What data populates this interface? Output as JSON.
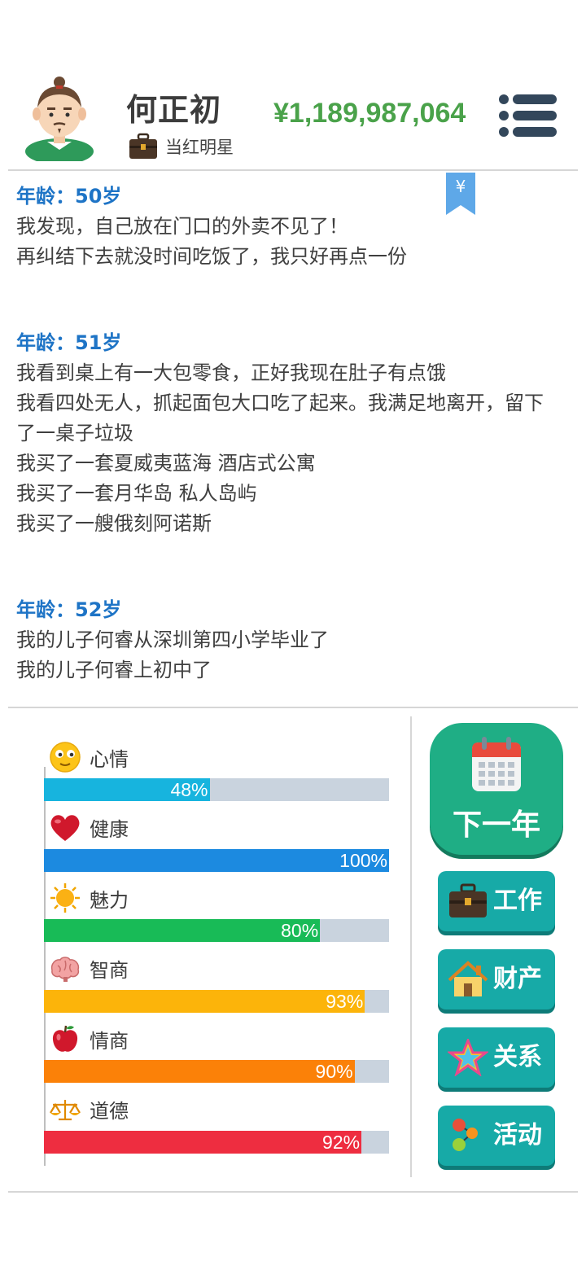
{
  "player": {
    "name": "何正初",
    "job": "当红明星",
    "money": "¥1,189,987,064"
  },
  "log": [
    {
      "age": "年龄：50岁",
      "events": [
        "我发现，自己放在门口的外卖不见了！",
        "再纠结下去就没时间吃饭了，我只好再点一份"
      ]
    },
    {
      "age": "年龄：51岁",
      "events": [
        "我看到桌上有一大包零食，正好我现在肚子有点饿",
        "我看四处无人，抓起面包大口吃了起来。我满足地离开，留下了一桌子垃圾",
        "我买了一套夏威夷蓝海 酒店式公寓",
        "我买了一套月华岛 私人岛屿",
        "我买了一艘俄刻阿诺斯"
      ]
    },
    {
      "age": "年龄：52岁",
      "events": [
        "我的儿子何睿从深圳第四小学毕业了",
        "我的儿子何睿上初中了"
      ]
    }
  ],
  "stats": [
    {
      "label": "心情",
      "value": 48,
      "text": "48%",
      "color": "#17b4de",
      "icon": "smiley-icon"
    },
    {
      "label": "健康",
      "value": 100,
      "text": "100%",
      "color": "#1c8ae0",
      "icon": "heart-icon"
    },
    {
      "label": "魅力",
      "value": 80,
      "text": "80%",
      "color": "#18bb57",
      "icon": "sun-icon"
    },
    {
      "label": "智商",
      "value": 93,
      "text": "93%",
      "color": "#fcb40a",
      "icon": "brain-icon"
    },
    {
      "label": "情商",
      "value": 90,
      "text": "90%",
      "color": "#fb8108",
      "icon": "apple-icon"
    },
    {
      "label": "道德",
      "value": 92,
      "text": "92%",
      "color": "#ee2d40",
      "icon": "scale-icon"
    }
  ],
  "actions": {
    "next_year": "下一年",
    "work": "工作",
    "property": "财产",
    "relations": "关系",
    "activities": "活动"
  },
  "icons": {
    "menu": "menu-icon",
    "bookmark": "yuan-bookmark-icon",
    "job": "briefcase-icon"
  }
}
